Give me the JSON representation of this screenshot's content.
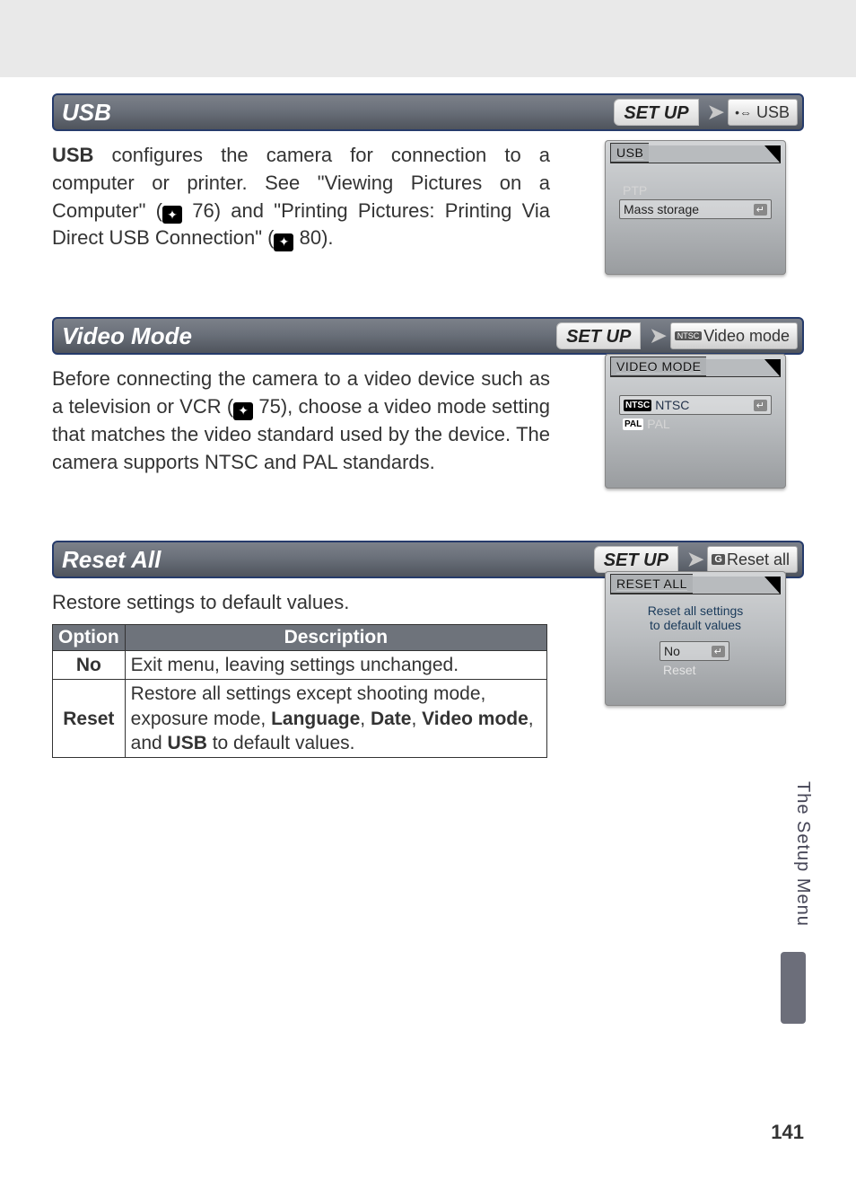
{
  "page_number": "141",
  "side_tab": "The Setup Menu",
  "sections": {
    "usb": {
      "title": "USB",
      "nav_setup": "SET UP",
      "nav_item": "USB",
      "body_pre": "USB",
      "body_mid1": " configures the camera for connection to a computer or printer.  See \"Viewing Pictures on a Computer\" (",
      "ref1": "76",
      "body_mid2": ") and \"Printing Pictures: Printing Via Direct USB Connection\" (",
      "ref2": "80",
      "body_tail": ").",
      "lcd": {
        "title": "USB",
        "opt1": "PTP",
        "opt2": "Mass storage"
      }
    },
    "video": {
      "title": "Video Mode",
      "nav_setup": "SET UP",
      "nav_icon": "NTSC",
      "nav_item": "Video mode",
      "body_pre": "Before connecting the camera to a video device such as a television or VCR (",
      "ref1": "75",
      "body_tail": "), choose a video mode setting that matches the video standard used by the device.  The camera supports NTSC and PAL standards.",
      "lcd": {
        "title": "VIDEO MODE",
        "opt1_icon": "NTSC",
        "opt1": "NTSC",
        "opt2_icon": "PAL",
        "opt2": "PAL"
      }
    },
    "reset": {
      "title": "Reset All",
      "nav_setup": "SET UP",
      "nav_icon": "G",
      "nav_item": "Reset all",
      "body": "Restore settings to default values.",
      "lcd": {
        "title": "RESET ALL",
        "msg1": "Reset all settings",
        "msg2": "to default values",
        "opt1": "No",
        "opt2": "Reset"
      },
      "table": {
        "h1": "Option",
        "h2": "Description",
        "r1c1": "No",
        "r1c2": "Exit menu, leaving settings unchanged.",
        "r2c1": "Reset",
        "r2c2a": "Restore all settings except shooting mode, exposure mode, ",
        "r2c2_b1": "Language",
        "r2c2_s1": ", ",
        "r2c2_b2": "Date",
        "r2c2_s2": ", ",
        "r2c2_b3": "Video mode",
        "r2c2_s3": ", and ",
        "r2c2_b4": "USB",
        "r2c2_tail": " to default values."
      }
    }
  }
}
